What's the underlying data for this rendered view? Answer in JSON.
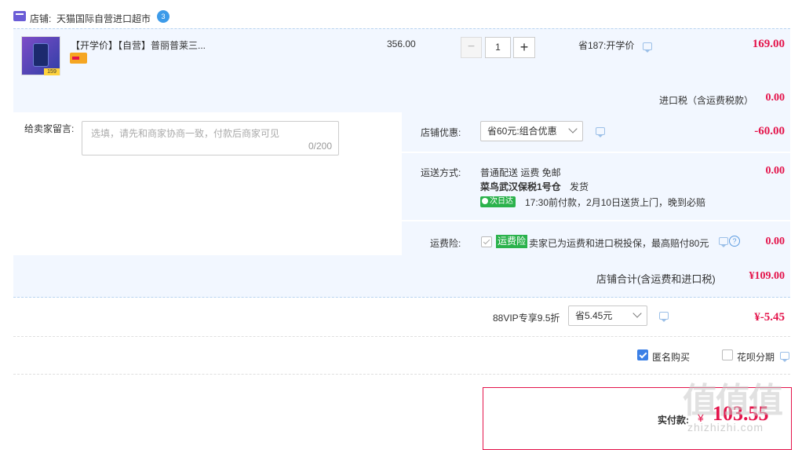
{
  "shop": {
    "label": "店铺:",
    "name": "天猫国际自营进口超市",
    "badge": "3"
  },
  "item": {
    "title": "【开学价】【自营】普丽普莱三...",
    "thumb_price_tag": "159",
    "unit_price": "356.00",
    "quantity": "1",
    "minus": "−",
    "plus": "+",
    "promo_text": "省187:开学价",
    "subtotal": "169.00",
    "tax_label": "进口税（含运费税款）",
    "tax_value": "0.00"
  },
  "message": {
    "label": "给卖家留言:",
    "placeholder": "选填，请先和商家协商一致，付款后商家可见",
    "counter": "0/200"
  },
  "discount": {
    "label": "店铺优惠:",
    "selected": "省60元:组合优惠",
    "amount": "-60.00"
  },
  "shipping": {
    "label": "运送方式:",
    "method": "普通配送 运费 免邮",
    "warehouse": "菜鸟武汉保税1号仓",
    "dispatch": "发货",
    "badge": "次日达",
    "delivery_note": "17:30前付款，2月10日送货上门，晚到必赔",
    "amount": "0.00"
  },
  "insurance": {
    "label": "运费险:",
    "tag": "运费险",
    "text": "卖家已为运费和进口税投保，最高赔付80元",
    "help": "?",
    "amount": "0.00"
  },
  "shop_total": {
    "label": "店铺合计(含运费和进口税)",
    "value": "¥109.00"
  },
  "vip": {
    "label": "88VIP专享9.5折",
    "selected": "省5.45元",
    "amount": "¥-5.45"
  },
  "options": {
    "anonymous": "匿名购买",
    "huabei": "花呗分期"
  },
  "payment": {
    "label": "实付款:",
    "currency": "¥",
    "value": "103.55"
  },
  "watermark": {
    "logo": "值值值",
    "domain": "zhizhizhi.com"
  },
  "colors": {
    "accent_red": "#e4144b",
    "panel_bg": "#f2f7ff",
    "border_blue": "#b8d4f0",
    "check_blue": "#3c80e6"
  }
}
